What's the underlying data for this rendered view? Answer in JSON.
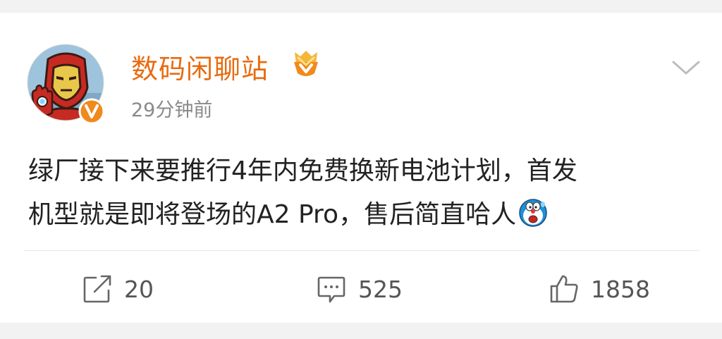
{
  "post": {
    "author": "数码闲聊站",
    "time": "29分钟前",
    "content_line1": "绿厂接下来要推行4年内免费换新电池计划，首发",
    "content_line2": "机型就是即将登场的A2 Pro，售后简直哈人",
    "emoji": "doraemon-scared-emoji"
  },
  "actions": {
    "repost_count": "20",
    "comment_count": "525",
    "like_count": "1858"
  },
  "colors": {
    "author": "#e86b10",
    "verified_badge": "#f08a1c",
    "muted_text": "#8a8a8a",
    "body_text": "#222222",
    "background": "#f2f2f2"
  }
}
